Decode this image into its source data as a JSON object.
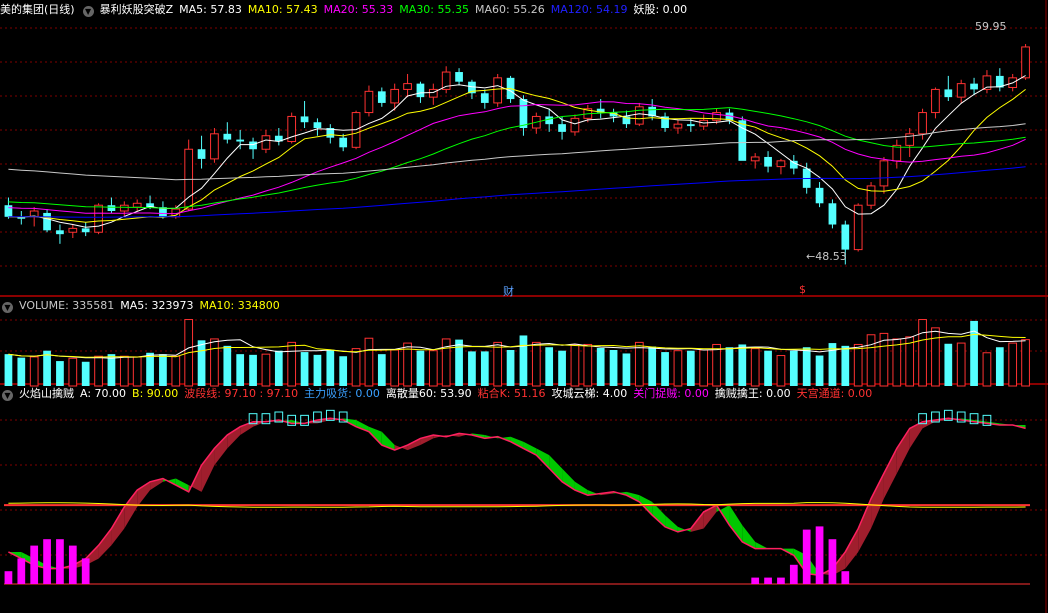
{
  "colors": {
    "up": "#ff3232",
    "down": "#54ffff",
    "ma5": "#ffffff",
    "ma10": "#ffff00",
    "ma20": "#ff00ff",
    "ma30": "#00ff00",
    "ma60": "#c8c8c8",
    "ma120": "#0000ff",
    "grid": "#800000",
    "sep": "#8b0000",
    "gray": "#c8c8c8",
    "shader": "#a01e2d",
    "shadeg": "#00c800",
    "vbar_up": "#ff3232",
    "vbar_dn": "#54ffff"
  },
  "panel1": {
    "title": "美的集团(日线)",
    "indicator": "暴利妖股突破Z",
    "ma5": "MA5: 57.83",
    "ma10": "MA10: 57.43",
    "ma20": "MA20: 55.33",
    "ma30": "MA30: 55.35",
    "ma60": "MA60: 55.26",
    "ma120": "MA120: 54.19",
    "yaogu": "妖股: 0.00",
    "high_label": "59.95",
    "low_label": "48.53",
    "event_cai": "财",
    "event_dollar": "$"
  },
  "panel2": {
    "title": "VOLUME: 335581",
    "ma5": "MA5: 323973",
    "ma10": "MA10: 334800"
  },
  "panel3": {
    "title": "火焰山擒贼",
    "a": "A: 70.00",
    "b": "B: 90.00",
    "bdx": "波段线: 97.10 : 97.10",
    "zlxh": "主力吸货: 0.00",
    "lsl": "离散量60: 53.90",
    "nhk": "粘合K: 51.16",
    "gcyt": "攻城云梯: 4.00",
    "gmzz": "关门捉贼: 0.00",
    "qzqw": "擒贼擒王: 0.00",
    "ttdd": "天宫通道: 0.00"
  },
  "chart_data": [
    {
      "type": "candlestick",
      "title": "美的集团(日线)",
      "n": 80,
      "ohlc": [
        [
          51.6,
          52.0,
          50.9,
          51.0
        ],
        [
          51.0,
          51.3,
          50.6,
          50.9
        ],
        [
          51.0,
          51.5,
          50.5,
          51.3
        ],
        [
          51.2,
          51.4,
          50.2,
          50.3
        ],
        [
          50.3,
          50.6,
          49.6,
          50.1
        ],
        [
          50.2,
          50.6,
          49.9,
          50.4
        ],
        [
          50.4,
          50.7,
          50.0,
          50.2
        ],
        [
          50.2,
          51.7,
          50.1,
          51.6
        ],
        [
          51.6,
          52.0,
          51.2,
          51.3
        ],
        [
          51.3,
          51.8,
          51.0,
          51.6
        ],
        [
          51.5,
          51.9,
          51.3,
          51.7
        ],
        [
          51.7,
          52.1,
          51.4,
          51.5
        ],
        [
          51.5,
          51.8,
          50.9,
          51.0
        ],
        [
          51.0,
          51.6,
          50.9,
          51.4
        ],
        [
          51.4,
          55.0,
          51.3,
          54.5
        ],
        [
          54.5,
          55.2,
          53.5,
          54.0
        ],
        [
          54.0,
          55.6,
          53.8,
          55.3
        ],
        [
          55.3,
          55.9,
          54.8,
          55.0
        ],
        [
          55.0,
          55.5,
          54.5,
          54.9
        ],
        [
          54.9,
          55.1,
          54.0,
          54.5
        ],
        [
          54.5,
          55.5,
          54.3,
          55.2
        ],
        [
          55.2,
          55.6,
          54.7,
          54.9
        ],
        [
          54.9,
          56.4,
          54.8,
          56.2
        ],
        [
          56.2,
          57.0,
          55.6,
          55.9
        ],
        [
          55.9,
          56.1,
          55.2,
          55.6
        ],
        [
          55.6,
          55.8,
          54.8,
          55.1
        ],
        [
          55.1,
          55.3,
          54.4,
          54.6
        ],
        [
          54.6,
          56.5,
          54.5,
          56.4
        ],
        [
          56.4,
          57.8,
          56.2,
          57.5
        ],
        [
          57.5,
          57.7,
          56.7,
          56.9
        ],
        [
          56.9,
          57.9,
          56.5,
          57.6
        ],
        [
          57.6,
          58.4,
          57.2,
          57.9
        ],
        [
          57.9,
          58.0,
          56.9,
          57.2
        ],
        [
          57.2,
          57.9,
          56.8,
          57.6
        ],
        [
          57.6,
          58.8,
          57.4,
          58.5
        ],
        [
          58.5,
          58.7,
          57.8,
          58.0
        ],
        [
          58.0,
          58.1,
          57.1,
          57.4
        ],
        [
          57.4,
          57.6,
          56.6,
          56.9
        ],
        [
          56.9,
          58.4,
          56.7,
          58.2
        ],
        [
          58.2,
          58.3,
          56.9,
          57.1
        ],
        [
          57.1,
          57.3,
          55.2,
          55.6
        ],
        [
          55.6,
          56.4,
          55.3,
          56.2
        ],
        [
          56.2,
          56.6,
          55.4,
          55.8
        ],
        [
          55.8,
          56.2,
          55.0,
          55.4
        ],
        [
          55.4,
          56.3,
          55.2,
          56.1
        ],
        [
          56.1,
          56.8,
          55.9,
          56.6
        ],
        [
          56.6,
          57.1,
          56.1,
          56.4
        ],
        [
          56.4,
          56.6,
          55.9,
          56.2
        ],
        [
          56.2,
          56.5,
          55.6,
          55.8
        ],
        [
          55.8,
          56.9,
          55.7,
          56.7
        ],
        [
          56.7,
          57.1,
          56.0,
          56.2
        ],
        [
          56.2,
          56.4,
          55.4,
          55.6
        ],
        [
          55.6,
          56.0,
          55.3,
          55.8
        ],
        [
          55.8,
          56.1,
          55.4,
          55.7
        ],
        [
          55.7,
          56.3,
          55.5,
          56.0
        ],
        [
          56.0,
          56.6,
          55.8,
          56.4
        ],
        [
          56.4,
          56.6,
          55.8,
          56.0
        ],
        [
          56.0,
          56.2,
          54.9,
          53.9
        ],
        [
          53.9,
          54.3,
          53.5,
          54.1
        ],
        [
          54.1,
          54.4,
          53.3,
          53.6
        ],
        [
          53.6,
          54.0,
          53.2,
          53.9
        ],
        [
          53.9,
          54.2,
          53.2,
          53.5
        ],
        [
          53.5,
          53.8,
          52.2,
          52.5
        ],
        [
          52.5,
          52.8,
          51.5,
          51.7
        ],
        [
          51.7,
          51.9,
          50.4,
          50.6
        ],
        [
          50.6,
          50.8,
          48.53,
          49.3
        ],
        [
          49.3,
          51.7,
          49.2,
          51.6
        ],
        [
          51.6,
          52.8,
          51.4,
          52.6
        ],
        [
          52.6,
          54.1,
          52.2,
          53.9
        ],
        [
          53.9,
          55.0,
          53.5,
          54.7
        ],
        [
          54.7,
          55.6,
          54.1,
          55.3
        ],
        [
          55.3,
          56.6,
          55.0,
          56.4
        ],
        [
          56.4,
          57.7,
          56.1,
          57.6
        ],
        [
          57.6,
          58.3,
          57.0,
          57.2
        ],
        [
          57.2,
          58.1,
          56.9,
          57.9
        ],
        [
          57.9,
          58.2,
          57.3,
          57.6
        ],
        [
          57.6,
          58.6,
          57.4,
          58.3
        ],
        [
          58.3,
          58.7,
          57.5,
          57.7
        ],
        [
          57.7,
          58.4,
          57.5,
          58.2
        ],
        [
          58.2,
          59.95,
          58.1,
          59.8
        ]
      ],
      "ylim": [
        47.0,
        61.3
      ],
      "ma_labels": [
        "MA5",
        "MA10",
        "MA20",
        "MA30",
        "MA60",
        "MA120"
      ]
    },
    {
      "type": "bar",
      "title": "VOLUME",
      "values": [
        230,
        205,
        210,
        255,
        180,
        200,
        175,
        215,
        230,
        215,
        210,
        240,
        230,
        215,
        480,
        330,
        340,
        290,
        230,
        225,
        230,
        255,
        315,
        245,
        225,
        260,
        215,
        270,
        345,
        230,
        260,
        310,
        255,
        255,
        340,
        335,
        250,
        250,
        315,
        260,
        365,
        315,
        280,
        255,
        300,
        300,
        275,
        260,
        235,
        315,
        285,
        245,
        255,
        255,
        260,
        300,
        280,
        300,
        270,
        255,
        220,
        255,
        280,
        220,
        310,
        290,
        300,
        370,
        380,
        340,
        355,
        480,
        420,
        305,
        310,
        470,
        240,
        280,
        310,
        335
      ],
      "ylim": [
        0,
        520
      ],
      "ma5_last": 323973,
      "ma10_last": 334800
    },
    {
      "type": "area",
      "title": "火焰山擒贼",
      "wave": [
        18,
        14,
        10,
        8,
        8,
        10,
        14,
        22,
        32,
        45,
        55,
        60,
        62,
        58,
        54,
        70,
        80,
        88,
        93,
        96,
        96,
        97,
        95,
        95,
        97,
        98,
        97,
        93,
        90,
        82,
        79,
        82,
        86,
        88,
        87,
        89,
        88,
        86,
        87,
        84,
        80,
        76,
        68,
        60,
        55,
        52,
        53,
        54,
        52,
        48,
        40,
        33,
        30,
        32,
        42,
        46,
        34,
        24,
        20,
        20,
        20,
        16,
        5,
        4,
        8,
        18,
        32,
        50,
        65,
        80,
        92,
        96,
        97,
        98,
        97,
        96,
        95,
        94,
        94,
        92
      ],
      "ylim": [
        0,
        100
      ]
    }
  ]
}
